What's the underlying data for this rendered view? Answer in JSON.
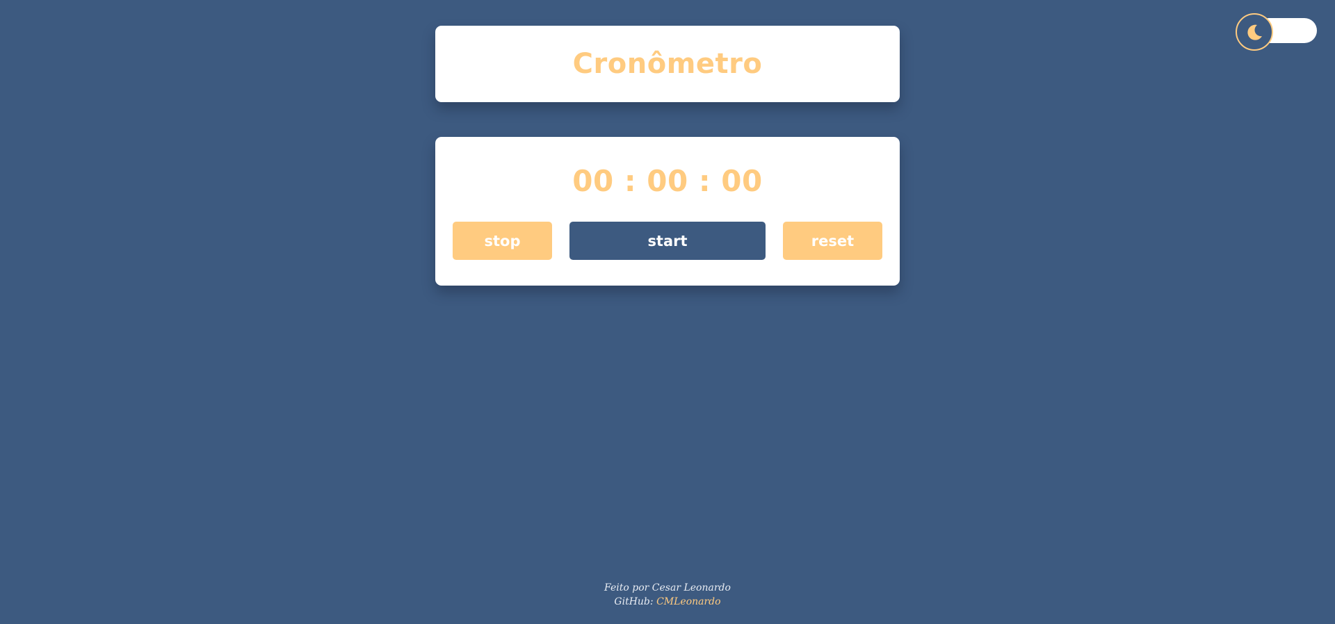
{
  "theme_toggle": {
    "icon": "moon-icon",
    "state": "dark"
  },
  "header": {
    "title": "Cronômetro"
  },
  "timer": {
    "display": "00 : 00 : 00",
    "hours": "00",
    "minutes": "00",
    "seconds": "00"
  },
  "controls": {
    "stop_label": "stop",
    "start_label": "start",
    "reset_label": "reset"
  },
  "footer": {
    "credit": "Feito por Cesar Leonardo",
    "github_prefix": "GitHub:",
    "github_user": "CMLeonardo"
  },
  "colors": {
    "background": "#3d5a80",
    "accent": "#ffcb80",
    "card": "#ffffff"
  }
}
